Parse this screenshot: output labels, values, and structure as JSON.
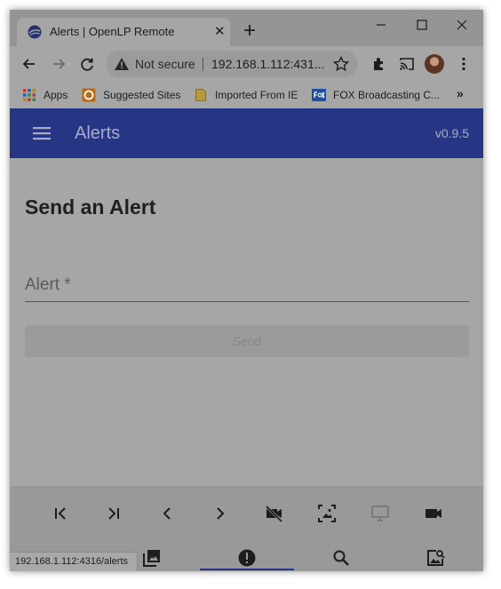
{
  "browser": {
    "tab_title": "Alerts | OpenLP Remote",
    "address": {
      "security_label": "Not secure",
      "url": "192.168.1.112:431..."
    },
    "bookmarks": [
      {
        "label": "Apps",
        "icon": "apps-grid-icon"
      },
      {
        "label": "Suggested Sites",
        "icon": "suggested-sites-icon"
      },
      {
        "label": "Imported From IE",
        "icon": "folder-icon"
      },
      {
        "label": "FOX Broadcasting C...",
        "icon": "fox-icon"
      }
    ],
    "status_url": "192.168.1.112:4316/alerts"
  },
  "app": {
    "title": "Alerts",
    "version": "v0.9.5"
  },
  "alerts": {
    "heading": "Send an Alert",
    "input_placeholder": "Alert *",
    "send_label": "Send"
  },
  "controls": [
    "first-slide-icon",
    "last-slide-icon",
    "previous-icon",
    "next-icon",
    "hide-display-icon",
    "blank-to-theme-icon",
    "show-display-icon",
    "live-video-icon"
  ],
  "bottom_nav": [
    "service-icon",
    "slides-icon",
    "alerts-icon",
    "search-icon",
    "themes-icon"
  ],
  "colors": {
    "appbar": "#273585",
    "overlay_gray": "#a6a6a6",
    "active_indicator": "#273585"
  }
}
